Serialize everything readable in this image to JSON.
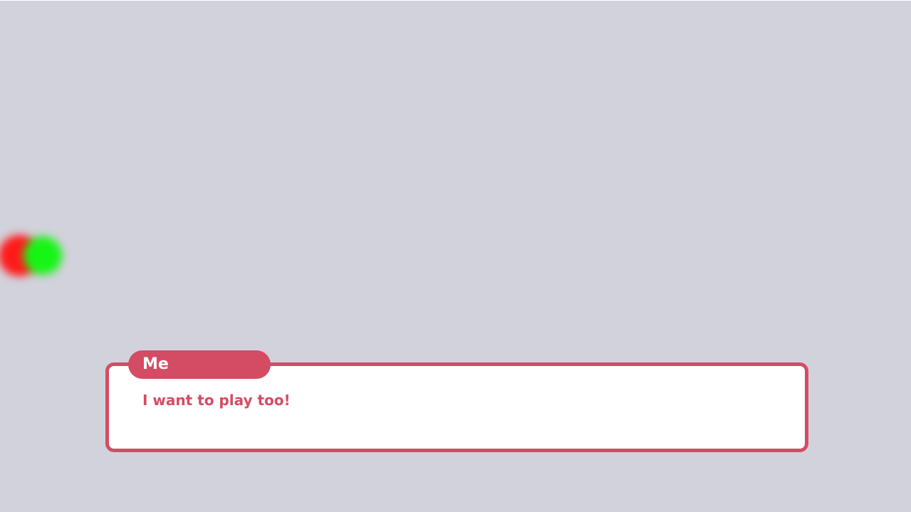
{
  "scene": {
    "background_color": "#d2d2dc",
    "sprites": [
      {
        "name": "red-orb",
        "color": "#ff1a1a"
      },
      {
        "name": "green-orb",
        "color": "#16f516"
      }
    ]
  },
  "dialogue": {
    "speaker": "Me",
    "text": "I want to play too!",
    "accent_color": "#d44c64",
    "box_color": "#ffffff"
  }
}
